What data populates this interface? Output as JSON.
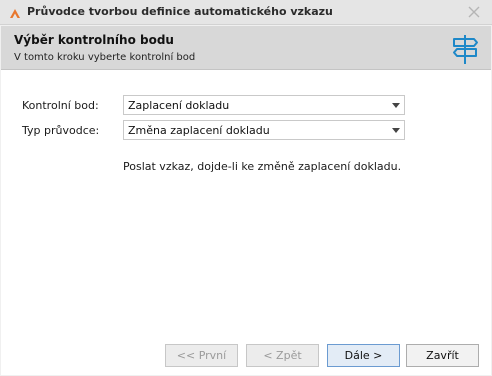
{
  "window": {
    "title": "Průvodce tvorbou definice automatického vzkazu",
    "icon": "app-logo-icon",
    "close_icon": "close-icon"
  },
  "header": {
    "title": "Výběr kontrolního bodu",
    "subtitle": "V tomto kroku vyberte kontrolní bod",
    "icon": "signpost-icon"
  },
  "form": {
    "checkpoint": {
      "label": "Kontrolní bod:",
      "value": "Zaplacení dokladu"
    },
    "wizard_type": {
      "label": "Typ průvodce:",
      "value": "Změna zaplacení dokladu"
    },
    "description": "Poslat vzkaz, dojde-li ke změně zaplacení dokladu."
  },
  "buttons": {
    "first": {
      "label": "<< První",
      "enabled": false
    },
    "back": {
      "label": "< Zpět",
      "enabled": false
    },
    "next": {
      "label": "Dále >",
      "enabled": true
    },
    "close": {
      "label": "Zavřít",
      "enabled": true
    }
  },
  "colors": {
    "header_bg": "#d8d8d8",
    "accent": "#1e88c8",
    "logo": "#e8772e"
  }
}
